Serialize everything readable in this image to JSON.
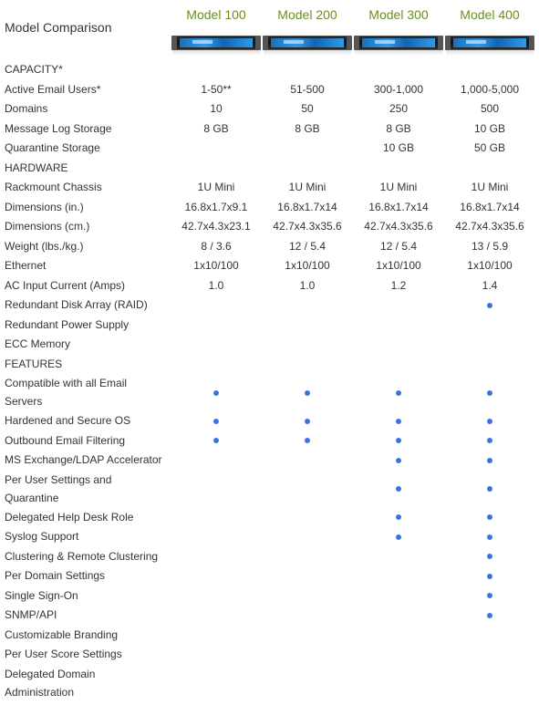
{
  "header": {
    "title": "Model Comparison",
    "models": [
      "Model 100",
      "Model 200",
      "Model 300",
      "Model 400"
    ]
  },
  "colors": {
    "model_name": "#6b8e1f",
    "dot": "#3b73e6"
  },
  "rows": [
    {
      "label": "CAPACITY*",
      "values": [
        "",
        "",
        "",
        ""
      ]
    },
    {
      "label": "Active Email Users*",
      "values": [
        "1-50**",
        "51-500",
        "300-1,000",
        "1,000-5,000"
      ]
    },
    {
      "label": "Domains",
      "values": [
        "10",
        "50",
        "250",
        "500"
      ]
    },
    {
      "label": "Message Log Storage",
      "values": [
        "8 GB",
        "8 GB",
        "8 GB",
        "10 GB"
      ]
    },
    {
      "label": "Quarantine Storage",
      "values": [
        "",
        "",
        "10 GB",
        "50 GB"
      ]
    },
    {
      "label": "HARDWARE",
      "values": [
        "",
        "",
        "",
        ""
      ]
    },
    {
      "label": "Rackmount Chassis",
      "values": [
        "1U Mini",
        "1U Mini",
        "1U Mini",
        "1U Mini"
      ]
    },
    {
      "label": "Dimensions (in.)",
      "values": [
        "16.8x1.7x9.1",
        "16.8x1.7x14",
        "16.8x1.7x14",
        "16.8x1.7x14"
      ]
    },
    {
      "label": "Dimensions (cm.)",
      "values": [
        "42.7x4.3x23.1",
        "42.7x4.3x35.6",
        "42.7x4.3x35.6",
        "42.7x4.3x35.6"
      ]
    },
    {
      "label": "Weight (lbs./kg.)",
      "values": [
        "8 / 3.6",
        "12 / 5.4",
        "12 / 5.4",
        "13 / 5.9"
      ]
    },
    {
      "label": "Ethernet",
      "values": [
        "1x10/100",
        "1x10/100",
        "1x10/100",
        "1x10/100"
      ]
    },
    {
      "label": "AC Input Current (Amps)",
      "values": [
        "1.0",
        "1.0",
        "1.2",
        "1.4"
      ]
    },
    {
      "label": "Redundant Disk Array (RAID)",
      "dots": [
        false,
        false,
        false,
        true
      ]
    },
    {
      "label": "Redundant Power Supply",
      "dots": [
        false,
        false,
        false,
        false
      ]
    },
    {
      "label": "ECC Memory",
      "dots": [
        false,
        false,
        false,
        false
      ]
    },
    {
      "label": "FEATURES",
      "values": [
        "",
        "",
        "",
        ""
      ]
    },
    {
      "label": "Compatible with all Email Servers",
      "dots": [
        true,
        true,
        true,
        true
      ]
    },
    {
      "label": "Hardened and Secure OS",
      "dots": [
        true,
        true,
        true,
        true
      ]
    },
    {
      "label": "Outbound Email Filtering",
      "dots": [
        true,
        true,
        true,
        true
      ]
    },
    {
      "label": "MS Exchange/LDAP Accelerator",
      "dots": [
        false,
        false,
        true,
        true
      ]
    },
    {
      "label": "Per User Settings and Quarantine",
      "dots": [
        false,
        false,
        true,
        true
      ]
    },
    {
      "label": "Delegated Help Desk Role",
      "dots": [
        false,
        false,
        true,
        true
      ]
    },
    {
      "label": "Syslog Support",
      "dots": [
        false,
        false,
        true,
        true
      ]
    },
    {
      "label": "Clustering & Remote Clustering",
      "dots": [
        false,
        false,
        false,
        true
      ]
    },
    {
      "label": "Per Domain Settings",
      "dots": [
        false,
        false,
        false,
        true
      ]
    },
    {
      "label": "Single Sign-On",
      "dots": [
        false,
        false,
        false,
        true
      ]
    },
    {
      "label": "SNMP/API",
      "dots": [
        false,
        false,
        false,
        true
      ]
    },
    {
      "label": "Customizable Branding",
      "dots": [
        false,
        false,
        false,
        false
      ]
    },
    {
      "label": "Per User Score Settings",
      "dots": [
        false,
        false,
        false,
        false
      ]
    },
    {
      "label": "Delegated Domain Administration",
      "dots": [
        false,
        false,
        false,
        false
      ]
    }
  ]
}
